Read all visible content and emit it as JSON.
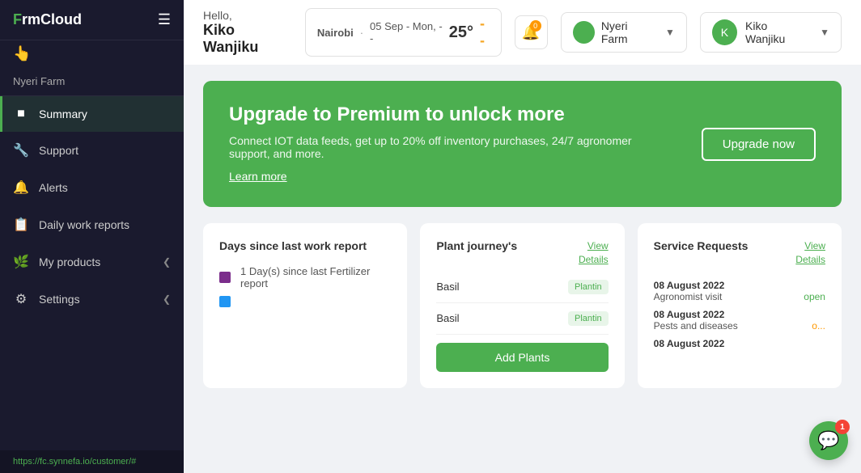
{
  "app": {
    "logo": "F rmCloud",
    "logo_green": "F",
    "logo_rest": "rmCloud"
  },
  "sidebar": {
    "farm_name": "Nyeri Farm",
    "nav_items": [
      {
        "id": "summary",
        "label": "Summary",
        "icon": "📊",
        "active": true,
        "has_arrow": false
      },
      {
        "id": "support",
        "label": "Support",
        "icon": "🔧",
        "active": false,
        "has_arrow": false
      },
      {
        "id": "alerts",
        "label": "Alerts",
        "icon": "🔔",
        "active": false,
        "has_arrow": false
      },
      {
        "id": "daily-work-reports",
        "label": "Daily work reports",
        "icon": "📋",
        "active": false,
        "has_arrow": false
      },
      {
        "id": "my-products",
        "label": "My products",
        "icon": "🌿",
        "active": false,
        "has_arrow": true
      },
      {
        "id": "settings",
        "label": "Settings",
        "icon": "⚙️",
        "active": false,
        "has_arrow": true
      }
    ],
    "footer_url": "https://fc.synnefa.io/customer/#"
  },
  "topbar": {
    "greeting_hello": "Hello,",
    "greeting_name": "Kiko Wanjiku",
    "weather": {
      "location": "Nairobi",
      "date": "05 Sep - Mon, --",
      "temp": "25°",
      "condition": "--"
    },
    "notification_count": "0",
    "farm_widget": {
      "name": "Nyeri Farm"
    },
    "user": {
      "name": "Kiko Wanjiku"
    }
  },
  "upgrade_banner": {
    "title": "Upgrade to Premium to unlock more",
    "description": "Connect IOT data feeds, get up to 20% off inventory purchases, 24/7 agronomer support, and more.",
    "learn_more": "Learn more",
    "button": "Upgrade now"
  },
  "cards": {
    "days_report": {
      "title": "Days since last work report",
      "items": [
        {
          "label": "1 Day(s) since last Fertilizer report",
          "sub": ""
        }
      ]
    },
    "plant_journeys": {
      "title": "Plant journey's",
      "view_details": "View\nDetails",
      "plants": [
        {
          "name": "Basil",
          "status": "Plantin"
        },
        {
          "name": "Basil",
          "status": "Plantin"
        }
      ],
      "add_button": "Add Plants"
    },
    "service_requests": {
      "title": "Service Requests",
      "view_details": "View\nDetails",
      "entries": [
        {
          "date": "08 August 2022",
          "description": "Agronomist visit",
          "status": "open",
          "status_color": "green"
        },
        {
          "date": "08 August 2022",
          "description": "Pests and diseases",
          "status": "o...",
          "status_color": "orange"
        },
        {
          "date": "08 August 2022",
          "description": "",
          "status": "",
          "status_color": ""
        }
      ]
    }
  },
  "chat": {
    "notif_count": "1"
  }
}
